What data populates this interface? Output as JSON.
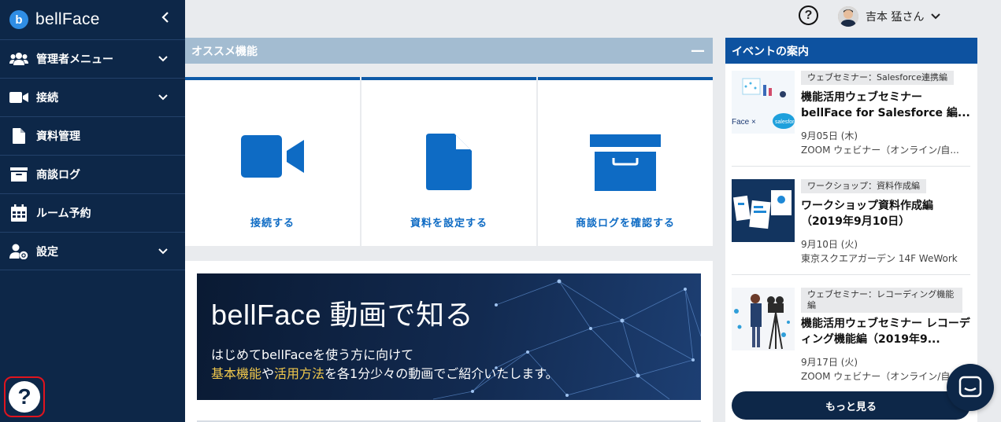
{
  "brand": {
    "letter": "b",
    "name": "bellFace"
  },
  "sidebar": {
    "items": [
      {
        "label": "管理者メニュー",
        "icon": "users-icon",
        "expandable": true
      },
      {
        "label": "接続",
        "icon": "video-icon",
        "expandable": true
      },
      {
        "label": "資料管理",
        "icon": "document-icon",
        "expandable": false
      },
      {
        "label": "商談ログ",
        "icon": "archive-icon",
        "expandable": false
      },
      {
        "label": "ルーム予約",
        "icon": "calendar-icon",
        "expandable": false
      },
      {
        "label": "設定",
        "icon": "user-gear-icon",
        "expandable": true
      }
    ],
    "help_symbol": "?"
  },
  "topbar": {
    "help_symbol": "?",
    "user_name": "吉本 猛さん"
  },
  "recommend": {
    "title": "オススメ機能",
    "minimize": "—",
    "cards": [
      {
        "label": "接続する",
        "icon": "video-icon"
      },
      {
        "label": "資料を設定する",
        "icon": "document-icon"
      },
      {
        "label": "商談ログを確認する",
        "icon": "archive-icon"
      }
    ]
  },
  "banner": {
    "title": "bellFace 動画で知る",
    "line1": "はじめてbellFaceを使う方に向けて",
    "line2_a": "基本機能",
    "line2_b": "や",
    "line2_c": "活用方法",
    "line2_d": "を各1分少々の動画でご紹介いたします。"
  },
  "events": {
    "title": "イベントの案内",
    "items": [
      {
        "tag": "ウェブセミナー：Salesforce連携編",
        "title": "機能活用ウェブセミナー bellFace for Salesforce 編...",
        "date": "9月05日 (木)",
        "place": "ZOOM ウェビナー（オンライン/自..."
      },
      {
        "tag": "ワークショップ：資料作成編",
        "title": "ワークショップ資料作成編（2019年9月10日）",
        "date": "9月10日 (火)",
        "place": "東京スクエアガーデン 14F WeWork"
      },
      {
        "tag": "ウェブセミナー：レコーディング機能編",
        "title": "機能活用ウェブセミナー レコーディング機能編（2019年9...",
        "date": "9月17日 (火)",
        "place": "ZOOM ウェビナー（オンライン/自..."
      }
    ],
    "more_label": "もっと見る"
  },
  "colors": {
    "sidebar": "#0d2748",
    "accent": "#0e6bc4",
    "events_header": "#0d52a0",
    "highlight": "#f2c94c"
  }
}
